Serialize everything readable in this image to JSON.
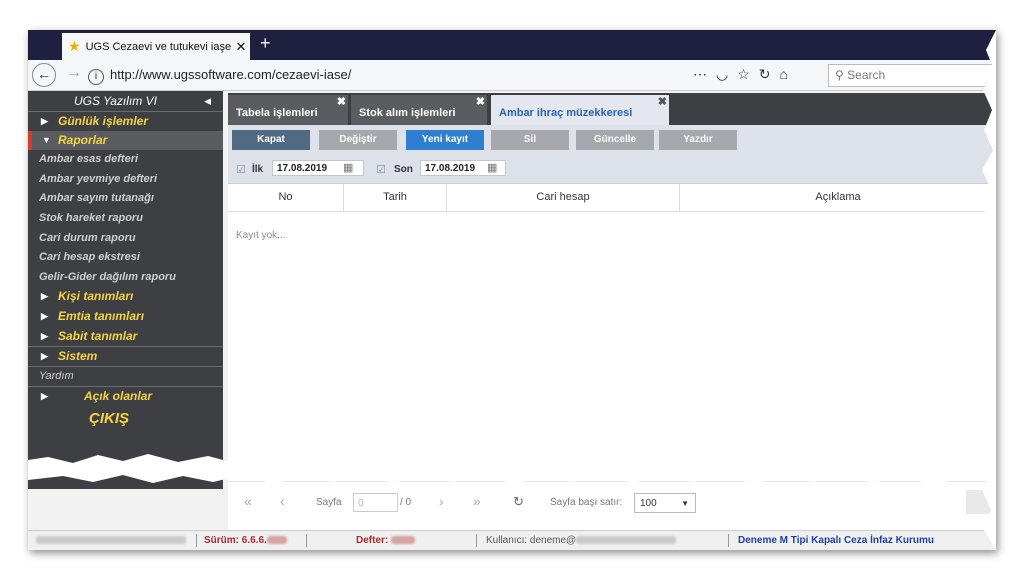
{
  "browser": {
    "tab_title": "UGS Cezaevi ve tutukevi iaşe ta",
    "tab_close": "✕",
    "new_tab": "+",
    "url": "http://www.ugssoftware.com/cezaevi-iase/",
    "search_placeholder": "Search",
    "icons": [
      "back-icon",
      "forward-icon",
      "info-icon",
      "more-icon",
      "pocket-icon",
      "star-icon",
      "reload-icon",
      "home-icon",
      "search-icon"
    ]
  },
  "sidebar": {
    "title": "UGS Yazılım VI",
    "items": [
      {
        "label": "Günlük işlemler"
      },
      {
        "label": "Raporlar"
      },
      {
        "label": "Kişi tanımları"
      },
      {
        "label": "Emtia tanımları"
      },
      {
        "label": "Sabit tanımlar"
      },
      {
        "label": "Sistem"
      },
      {
        "label": "Açık olanlar"
      }
    ],
    "sub_items": [
      "Ambar esas defteri",
      "Ambar yevmiye defteri",
      "Ambar sayım tutanağı",
      "Stok hareket raporu",
      "Cari durum raporu",
      "Cari hesap ekstresi",
      "Gelir-Gider dağılım raporu"
    ],
    "help": "Yardım",
    "exit": "ÇIKIŞ"
  },
  "tabs": [
    {
      "label": "Tabela işlemleri"
    },
    {
      "label": "Stok alım işlemleri"
    },
    {
      "label": "Ambar ihraç müzekkeresi"
    }
  ],
  "toolbar": {
    "kapat": "Kapat",
    "degistir": "Değiştir",
    "yeni_kayit": "Yeni kayıt",
    "sil": "Sil",
    "guncelle": "Güncelle",
    "yazdir": "Yazdır"
  },
  "dates": {
    "ilk_label": "İlk",
    "ilk_value": "17.08.2019",
    "son_label": "Son",
    "son_value": "17.08.2019"
  },
  "table": {
    "columns": [
      "No",
      "Tarih",
      "Cari hesap",
      "Açıklama"
    ],
    "empty_text": "Kayıt yok..."
  },
  "pager": {
    "first": "«",
    "prev": "‹",
    "page_label": "Sayfa",
    "page_value": "0",
    "page_total": "/ 0",
    "next": "›",
    "last": "»",
    "refresh": "↻",
    "rows_label": "Sayfa başı satır:",
    "rows_value": "100"
  },
  "status": {
    "version_label": "Sürüm: 6.6.6.",
    "defter_label": "Defter:",
    "user_label": "Kullanıcı: deneme@",
    "institution": "Deneme M Tipi Kapalı Ceza İnfaz Kurumu"
  },
  "colors": {
    "sidebar_bg": "#3e3f42",
    "sidebar_accent": "#f5d442",
    "active_marker": "#d23b2e",
    "btn_dark": "#4f6a82",
    "btn_blue": "#2f7fd1",
    "btn_gray": "#a6a8ad",
    "active_tab_text": "#2b65a9",
    "institution_text": "#1f3fa8"
  }
}
